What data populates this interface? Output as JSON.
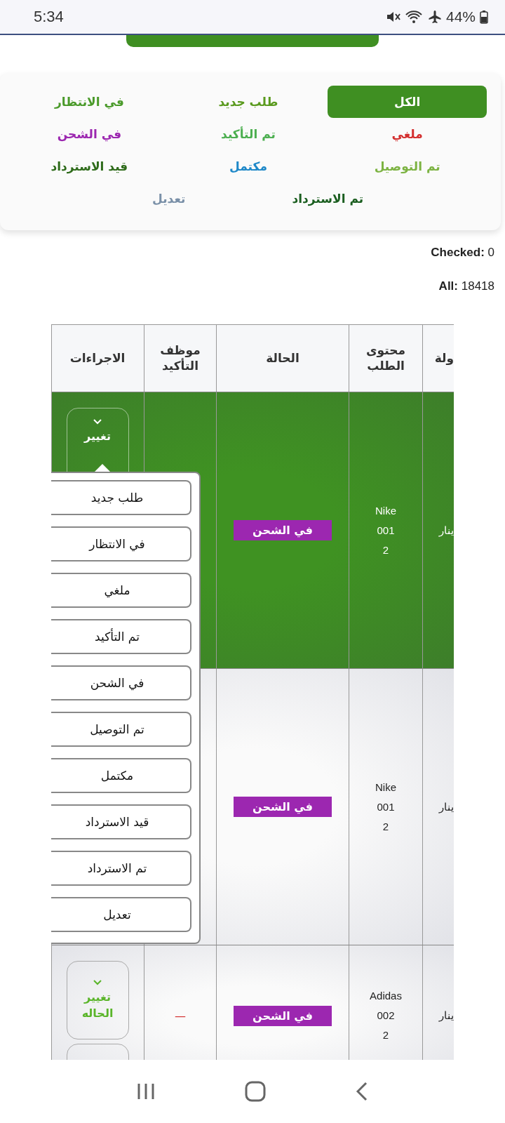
{
  "status_bar": {
    "time": "5:34",
    "battery": "44%"
  },
  "filters": [
    {
      "label": "الكل",
      "color": "#3f8f22",
      "selected": true
    },
    {
      "label": "طلب جديد",
      "color": "#5a9a1e",
      "selected": false
    },
    {
      "label": "في الانتظار",
      "color": "#4a9a2a",
      "selected": false
    },
    {
      "label": "ملغي",
      "color": "#d32f2f",
      "selected": false
    },
    {
      "label": "تم التأكيد",
      "color": "#4caf50",
      "selected": false
    },
    {
      "label": "في الشحن",
      "color": "#9c27b0",
      "selected": false
    },
    {
      "label": "تم التوصيل",
      "color": "#7cb342",
      "selected": false
    },
    {
      "label": "مكتمل",
      "color": "#1e88c8",
      "selected": false
    },
    {
      "label": "قيد الاسترداد",
      "color": "#2e6b1a",
      "selected": false
    },
    {
      "label": "تم الاسترداد",
      "color": "#1b5e20",
      "selected": false
    },
    {
      "label": "تعديل",
      "color": "#7a90a8",
      "selected": false
    }
  ],
  "counts": [
    "**Checked:** 0",
    "**All:** 18418"
  ],
  "table": {
    "columns": [
      "ولة",
      "محتوى الطلب",
      "الحالة",
      "موظف التأكيد",
      "الاجراءات"
    ],
    "rows": [
      {
        "selected": true,
        "column_1": "ينار",
        "content": [
          "Nike",
          "001",
          "2"
        ],
        "status": {
          "label": "في الشحن",
          "color": "#9c27b0"
        },
        "confirmer": "",
        "action": "تغيير",
        "menu_open": true
      },
      {
        "selected": false,
        "column_1": "ينار",
        "content": [
          "Nike",
          "001",
          "2"
        ],
        "status": {
          "label": "في الشحن",
          "color": "#9c27b0"
        },
        "confirmer": "",
        "action": "",
        "menu_open": false
      },
      {
        "selected": false,
        "column_1": "ينار",
        "content": [
          "Adidas",
          "002",
          "2"
        ],
        "status": {
          "label": "في الشحن",
          "color": "#9c27b0"
        },
        "confirmer": "—",
        "action": "تغيير الحاله",
        "menu_open": false
      }
    ]
  },
  "status_menu": {
    "options": [
      "طلب جديد",
      "في الانتظار",
      "ملغي",
      "تم التأكيد",
      "في الشحن",
      "تم التوصيل",
      "مكتمل",
      "قيد الاسترداد",
      "تم الاسترداد",
      "تعديل"
    ]
  }
}
